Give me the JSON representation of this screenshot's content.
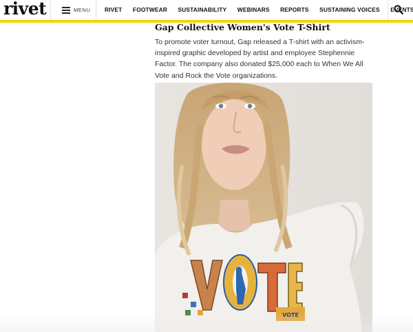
{
  "header": {
    "logo": "rivet",
    "menu_label": "MENU",
    "nav": [
      "RIVET",
      "FOOTWEAR",
      "SUSTAINABILITY",
      "WEBINARS",
      "REPORTS",
      "SUSTAINING VOICES",
      "EVENTS"
    ],
    "accent_color": "#f5d400"
  },
  "article": {
    "title": "Gap Collective Women's Vote T-Shirt",
    "paragraph": "To promote voter turnout, Gap released a T-shirt with an activism-inspired graphic developed by artist and employee Stephennie Factor. The company also donated $25,000 each to When We All Vote and Rock the Vote organizations."
  },
  "image": {
    "shirt_text": "VOTE"
  }
}
